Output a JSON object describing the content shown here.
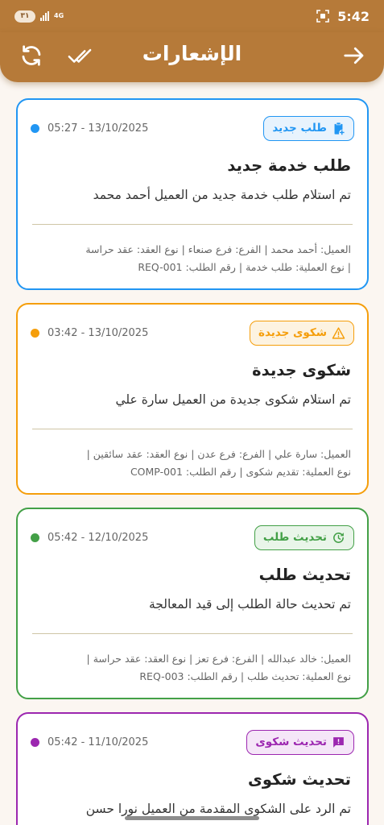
{
  "status_bar": {
    "time": "5:42",
    "battery_badge": "٣١",
    "network": "4G"
  },
  "app_bar": {
    "title": "الإشعارات",
    "icons": [
      "refresh-icon",
      "double-check-icon",
      "arrow-forward-icon"
    ]
  },
  "notifications": [
    {
      "color": "#2196f3",
      "bg": "#e8f3fd",
      "date": "05:27 - 13/10/2025",
      "badge": "طلب جديد",
      "badge_icon": "clipboard-add-icon",
      "title": "طلب خدمة جديد",
      "message": "تم استلام طلب خدمة جديد من العميل أحمد محمد",
      "details_line1": "العميل: أحمد محمد | الفرع: فرع صنعاء | نوع العقد: عقد حراسة",
      "details_line2": "| نوع العملية: طلب خدمة | رقم الطلب: REQ-001"
    },
    {
      "color": "#f59e0b",
      "bg": "#fdf3e1",
      "date": "03:42 - 13/10/2025",
      "badge": "شكوى جديدة",
      "badge_icon": "warning-icon",
      "title": "شكوى جديدة",
      "message": "تم استلام شكوى جديدة من العميل سارة علي",
      "details_line1": "العميل: سارة علي | الفرع: فرع عدن | نوع العقد: عقد سائقين |",
      "details_line2": "نوع العملية: تقديم شكوى | رقم الطلب: COMP-001"
    },
    {
      "color": "#43a047",
      "bg": "#e9f5e9",
      "date": "05:42 - 12/10/2025",
      "badge": "تحديث طلب",
      "badge_icon": "update-icon",
      "title": "تحديث طلب",
      "message": "تم تحديث حالة الطلب إلى قيد المعالجة",
      "details_line1": "العميل: خالد عبدالله | الفرع: فرع تعز | نوع العقد: عقد حراسة |",
      "details_line2": "نوع العملية: تحديث طلب | رقم الطلب: REQ-003"
    },
    {
      "color": "#9c27b0",
      "bg": "#f5e6f8",
      "date": "05:42 - 11/10/2025",
      "badge": "تحديث شكوى",
      "badge_icon": "feedback-icon",
      "title": "تحديث شكوى",
      "message": "تم الرد على الشكوى المقدمة من العميل نورا حسن",
      "details_line1": "",
      "details_line2": ""
    }
  ]
}
